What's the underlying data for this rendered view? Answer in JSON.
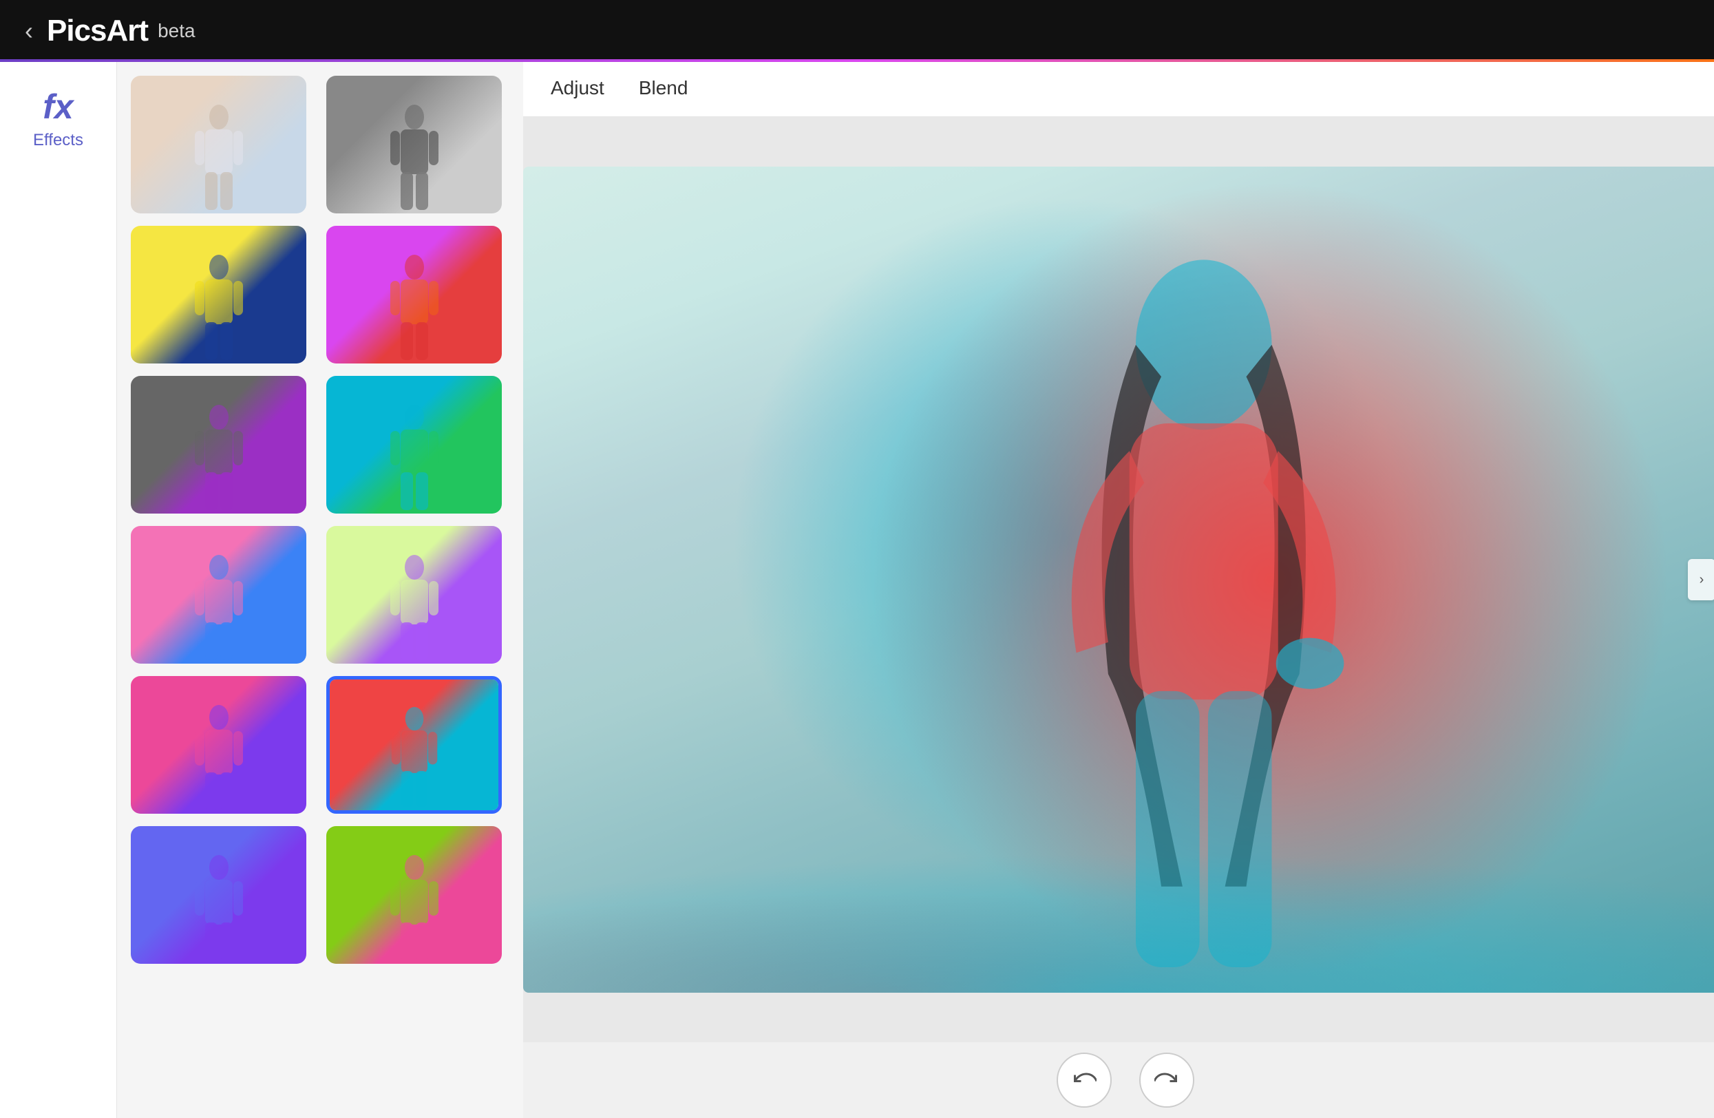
{
  "app": {
    "name": "PicsArt",
    "version": "beta",
    "back_label": "‹"
  },
  "sidebar": {
    "fx_symbol": "fx",
    "fx_label": "Effects"
  },
  "toolbar": {
    "tabs": [
      {
        "id": "adjust",
        "label": "Adjust",
        "active": false
      },
      {
        "id": "blend",
        "label": "Blend",
        "active": false
      }
    ]
  },
  "effects": {
    "items": [
      {
        "id": 1,
        "style": "original",
        "selected": false
      },
      {
        "id": 2,
        "style": "bw",
        "selected": false
      },
      {
        "id": 3,
        "style": "yellow-blue",
        "selected": false
      },
      {
        "id": 4,
        "style": "pink-red",
        "selected": false
      },
      {
        "id": 5,
        "style": "grey-purple",
        "selected": false
      },
      {
        "id": 6,
        "style": "teal-green",
        "selected": false
      },
      {
        "id": 7,
        "style": "pink-blue",
        "selected": false
      },
      {
        "id": 8,
        "style": "lime-purple",
        "selected": false
      },
      {
        "id": 9,
        "style": "magenta-purple",
        "selected": false
      },
      {
        "id": 10,
        "style": "red-cyan",
        "selected": true
      },
      {
        "id": 11,
        "style": "blue-violet",
        "selected": false
      },
      {
        "id": 12,
        "style": "lime-pink",
        "selected": false
      }
    ]
  },
  "actions": {
    "undo_label": "↩",
    "redo_label": "↪",
    "collapse_right": "›",
    "collapse_left": "‹"
  }
}
